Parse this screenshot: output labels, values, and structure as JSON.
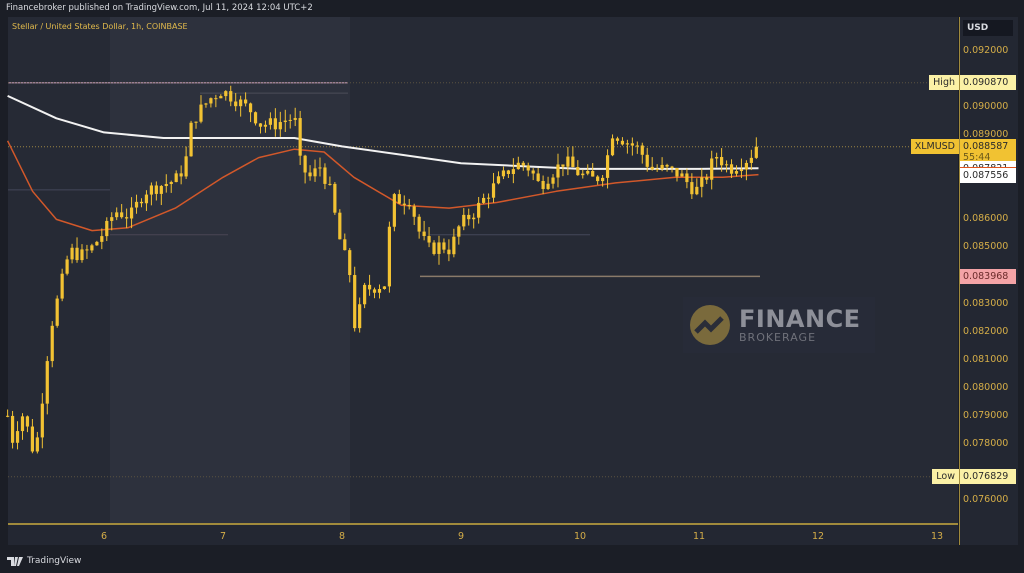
{
  "header": {
    "published": "Financebroker published on TradingView.com, Jul 11, 2024 12:04 UTC+2"
  },
  "chart_data": {
    "type": "candlestick",
    "title": "Stellar / United States Dollar, 1h, COINBASE",
    "symbol": "XLMUSD",
    "currency": "USD",
    "x_ticks": [
      "6",
      "7",
      "8",
      "9",
      "10",
      "11",
      "12",
      "13"
    ],
    "xlim": [
      5.17,
      13.2
    ],
    "ylim": [
      0.0753,
      0.0932
    ],
    "y_ticks": [
      "0.092000",
      "0.090000",
      "0.089000",
      "0.086000",
      "0.085000",
      "0.083000",
      "0.082000",
      "0.081000",
      "0.080000",
      "0.079000",
      "0.078000",
      "0.076000"
    ],
    "price_path": [
      [
        5.19,
        0.079
      ],
      [
        5.24,
        0.078
      ],
      [
        5.3,
        0.0792
      ],
      [
        5.36,
        0.0785
      ],
      [
        5.42,
        0.0775
      ],
      [
        5.5,
        0.0803
      ],
      [
        5.55,
        0.0821
      ],
      [
        5.63,
        0.0835
      ],
      [
        5.71,
        0.0849
      ],
      [
        5.8,
        0.0847
      ],
      [
        5.88,
        0.0849
      ],
      [
        6.01,
        0.0856
      ],
      [
        6.09,
        0.0863
      ],
      [
        6.22,
        0.0861
      ],
      [
        6.34,
        0.087
      ],
      [
        6.47,
        0.0872
      ],
      [
        6.6,
        0.0874
      ],
      [
        6.68,
        0.0879
      ],
      [
        6.74,
        0.0895
      ],
      [
        6.81,
        0.0899
      ],
      [
        6.89,
        0.0903
      ],
      [
        6.99,
        0.0906
      ],
      [
        7.1,
        0.0903
      ],
      [
        7.23,
        0.0899
      ],
      [
        7.31,
        0.0894
      ],
      [
        7.44,
        0.0894
      ],
      [
        7.56,
        0.0896
      ],
      [
        7.63,
        0.0894
      ],
      [
        7.65,
        0.0879
      ],
      [
        7.73,
        0.0875
      ],
      [
        7.82,
        0.0879
      ],
      [
        7.9,
        0.087
      ],
      [
        7.98,
        0.0853
      ],
      [
        8.07,
        0.084
      ],
      [
        8.11,
        0.0821
      ],
      [
        8.19,
        0.0835
      ],
      [
        8.28,
        0.0836
      ],
      [
        8.36,
        0.0837
      ],
      [
        8.42,
        0.0867
      ],
      [
        8.57,
        0.0867
      ],
      [
        8.66,
        0.0854
      ],
      [
        8.74,
        0.0849
      ],
      [
        8.83,
        0.0851
      ],
      [
        8.91,
        0.0849
      ],
      [
        8.99,
        0.0858
      ],
      [
        9.12,
        0.0863
      ],
      [
        9.24,
        0.087
      ],
      [
        9.41,
        0.0878
      ],
      [
        9.5,
        0.088
      ],
      [
        9.58,
        0.0878
      ],
      [
        9.66,
        0.0872
      ],
      [
        9.75,
        0.0876
      ],
      [
        9.87,
        0.0881
      ],
      [
        10.0,
        0.0876
      ],
      [
        10.13,
        0.0874
      ],
      [
        10.21,
        0.0878
      ],
      [
        10.27,
        0.0891
      ],
      [
        10.38,
        0.0888
      ],
      [
        10.5,
        0.0885
      ],
      [
        10.59,
        0.0878
      ],
      [
        10.71,
        0.0878
      ],
      [
        10.84,
        0.0876
      ],
      [
        10.97,
        0.087
      ],
      [
        11.05,
        0.0874
      ],
      [
        11.14,
        0.0883
      ],
      [
        11.26,
        0.0878
      ],
      [
        11.39,
        0.0881
      ],
      [
        11.5,
        0.088587
      ]
    ],
    "ma_white": [
      [
        5.19,
        0.0904
      ],
      [
        5.6,
        0.0896
      ],
      [
        6.0,
        0.0891
      ],
      [
        6.5,
        0.0889
      ],
      [
        7.0,
        0.0889
      ],
      [
        7.6,
        0.0889
      ],
      [
        8.0,
        0.0886
      ],
      [
        8.5,
        0.0883
      ],
      [
        9.0,
        0.088
      ],
      [
        9.5,
        0.0879
      ],
      [
        10.0,
        0.0878
      ],
      [
        10.5,
        0.0878
      ],
      [
        11.0,
        0.0878
      ],
      [
        11.5,
        0.087821
      ]
    ],
    "ma_orange": [
      [
        5.19,
        0.0888
      ],
      [
        5.4,
        0.087
      ],
      [
        5.6,
        0.086
      ],
      [
        5.9,
        0.0856
      ],
      [
        6.2,
        0.0857
      ],
      [
        6.6,
        0.0864
      ],
      [
        7.0,
        0.0875
      ],
      [
        7.3,
        0.0882
      ],
      [
        7.6,
        0.0885
      ],
      [
        7.85,
        0.0884
      ],
      [
        8.1,
        0.0875
      ],
      [
        8.5,
        0.0865
      ],
      [
        8.9,
        0.0864
      ],
      [
        9.3,
        0.0866
      ],
      [
        9.8,
        0.087
      ],
      [
        10.3,
        0.0873
      ],
      [
        10.8,
        0.0875
      ],
      [
        11.2,
        0.0875
      ],
      [
        11.5,
        0.087595
      ]
    ],
    "levels": {
      "high": 0.09087,
      "low": 0.076829,
      "support": 0.083968,
      "last": 0.088587
    },
    "price_labels": [
      {
        "tag": "High",
        "value": "0.090870",
        "price": 0.09087,
        "bg": "#fbf1a6",
        "fg": "#2b2b2b"
      },
      {
        "tag": "XLMUSD",
        "value": "0.088587",
        "price": 0.088587,
        "bg": "#f1c232",
        "fg": "#2b2b2b",
        "countdown": "55:44"
      },
      {
        "tag": "",
        "value": "0.087821",
        "price": 0.087821,
        "bg": "#ffffff",
        "fg": "#2b2b2b"
      },
      {
        "tag": "",
        "value": "0.087595",
        "price": 0.087595,
        "bg": "#e2571e",
        "fg": "#ffffff"
      },
      {
        "tag": "",
        "value": "0.087556",
        "price": 0.087556,
        "bg": "#ffffff",
        "fg": "#2b2b2b"
      },
      {
        "tag": "",
        "value": "0.083968",
        "price": 0.083968,
        "bg": "#f4a3a6",
        "fg": "#6b2b2b"
      },
      {
        "tag": "Low",
        "value": "0.076829",
        "price": 0.076829,
        "bg": "#fbf1a6",
        "fg": "#2b2b2b"
      }
    ],
    "colors": {
      "candle": "#f2c233",
      "ma_white": "#f2f2f2",
      "ma_orange": "#d2582a",
      "axis_text": "#d4ad48"
    }
  },
  "watermark": {
    "line1": "FINANCE",
    "line2": "BROKERAGE"
  },
  "footer": {
    "brand": "TradingView"
  }
}
